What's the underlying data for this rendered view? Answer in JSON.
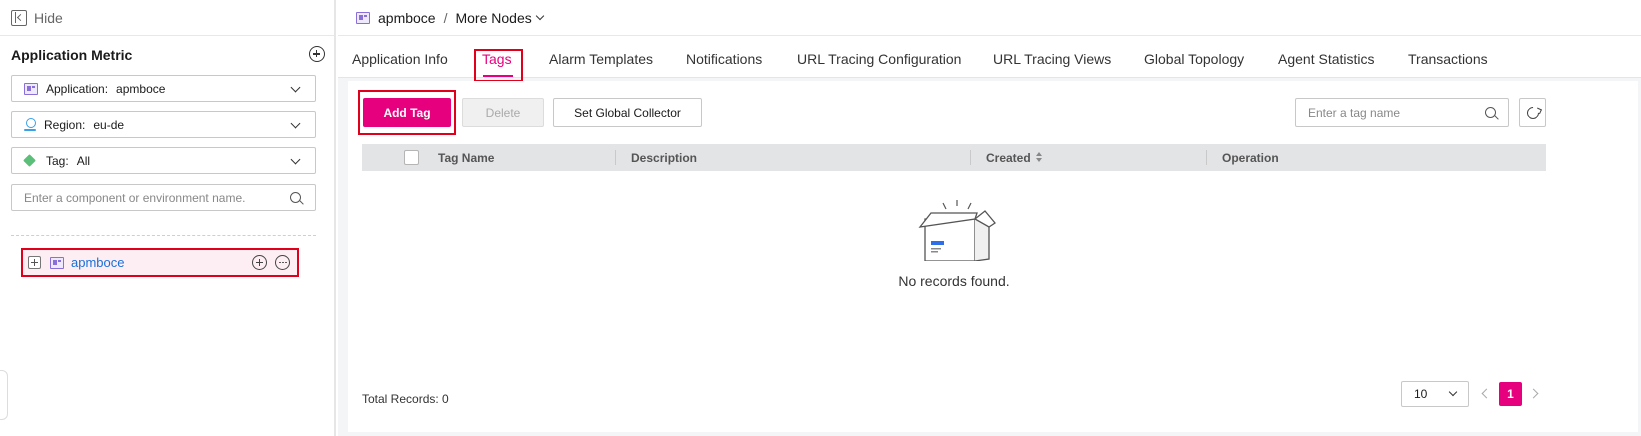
{
  "sidebar": {
    "hide_label": "Hide",
    "title": "Application Metric",
    "filters": {
      "application": {
        "label": "Application:",
        "value": "apmboce"
      },
      "region": {
        "label": "Region:",
        "value": "eu-de"
      },
      "tag": {
        "label": "Tag:",
        "value": "All"
      }
    },
    "search": {
      "placeholder": "Enter a component or environment name."
    },
    "tree": [
      {
        "label": "apmboce"
      }
    ]
  },
  "breadcrumb": {
    "app": "apmboce",
    "separator": "/",
    "more": "More Nodes"
  },
  "tabs": [
    {
      "label": "Application Info"
    },
    {
      "label": "Tags",
      "active": true
    },
    {
      "label": "Alarm Templates"
    },
    {
      "label": "Notifications"
    },
    {
      "label": "URL Tracing Configuration"
    },
    {
      "label": "URL Tracing Views"
    },
    {
      "label": "Global Topology"
    },
    {
      "label": "Agent Statistics"
    },
    {
      "label": "Transactions"
    }
  ],
  "toolbar": {
    "add_label": "Add Tag",
    "delete_label": "Delete",
    "collector_label": "Set Global Collector",
    "search_placeholder": "Enter a tag name"
  },
  "table": {
    "columns": [
      "Tag Name",
      "Description",
      "Created",
      "Operation"
    ],
    "empty_text": "No records found."
  },
  "pagination": {
    "total_text": "Total Records: 0",
    "page_size": "10",
    "current_page": "1"
  },
  "colors": {
    "accent": "#e6007e",
    "highlight_border": "#e0001b",
    "link": "#1a6fd8"
  }
}
